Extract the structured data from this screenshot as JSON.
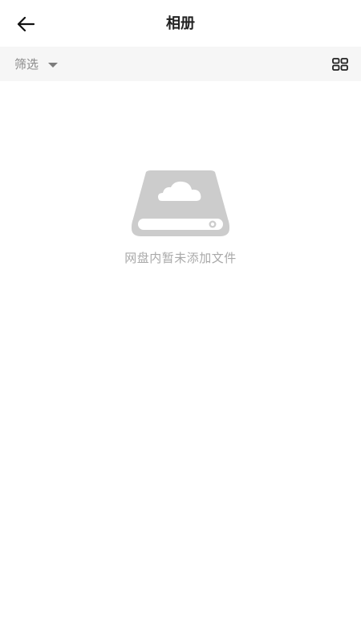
{
  "header": {
    "title": "相册",
    "back_icon": "arrow-left-icon"
  },
  "filter_bar": {
    "filter_label": "筛选",
    "filter_icon": "caret-down-icon",
    "view_toggle_icon": "grid-view-icon"
  },
  "empty_state": {
    "icon": "cloud-drive-icon",
    "message": "网盘内暂未添加文件"
  },
  "colors": {
    "filter_bar_bg": "#f6f6f6",
    "empty_icon": "#cccccc",
    "empty_text": "#a9a9a9"
  }
}
